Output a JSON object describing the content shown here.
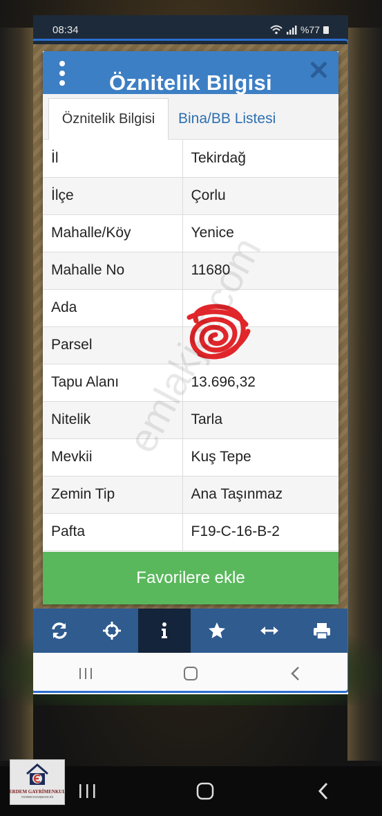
{
  "status_bar": {
    "time": "08:34",
    "battery": "%77"
  },
  "modal": {
    "title": "Öznitelik Bilgisi",
    "tabs": [
      {
        "label": "Öznitelik Bilgisi",
        "active": true
      },
      {
        "label": "Bina/BB Listesi",
        "active": false
      }
    ],
    "rows": [
      {
        "key": "İl",
        "value": "Tekirdağ"
      },
      {
        "key": "İlçe",
        "value": "Çorlu"
      },
      {
        "key": "Mahalle/Köy",
        "value": "Yenice"
      },
      {
        "key": "Mahalle No",
        "value": "11680"
      },
      {
        "key": "Ada",
        "value": ""
      },
      {
        "key": "Parsel",
        "value": ""
      },
      {
        "key": "Tapu Alanı",
        "value": "13.696,32"
      },
      {
        "key": "Nitelik",
        "value": "Tarla"
      },
      {
        "key": "Mevkii",
        "value": "Kuş Tepe"
      },
      {
        "key": "Zemin Tip",
        "value": "Ana Taşınmaz"
      },
      {
        "key": "Pafta",
        "value": "F19-C-16-B-2"
      }
    ],
    "favorite_button": "Favorilere ekle"
  },
  "watermark": "emlakjet.com",
  "toolbar": {
    "items": [
      "refresh-icon",
      "crosshair-icon",
      "info-icon",
      "star-icon",
      "arrows-horizontal-icon",
      "print-icon"
    ],
    "active": "info-icon",
    "color": "#2f5b8f"
  },
  "logo": {
    "name": "ERDEM GAYRİMENKUL",
    "sub": "YATIRIM DANIŞMANLIĞI"
  },
  "colors": {
    "header_blue": "#3d7fc4",
    "favorite_green": "#59b85c",
    "tab_link": "#2e6fb0"
  }
}
